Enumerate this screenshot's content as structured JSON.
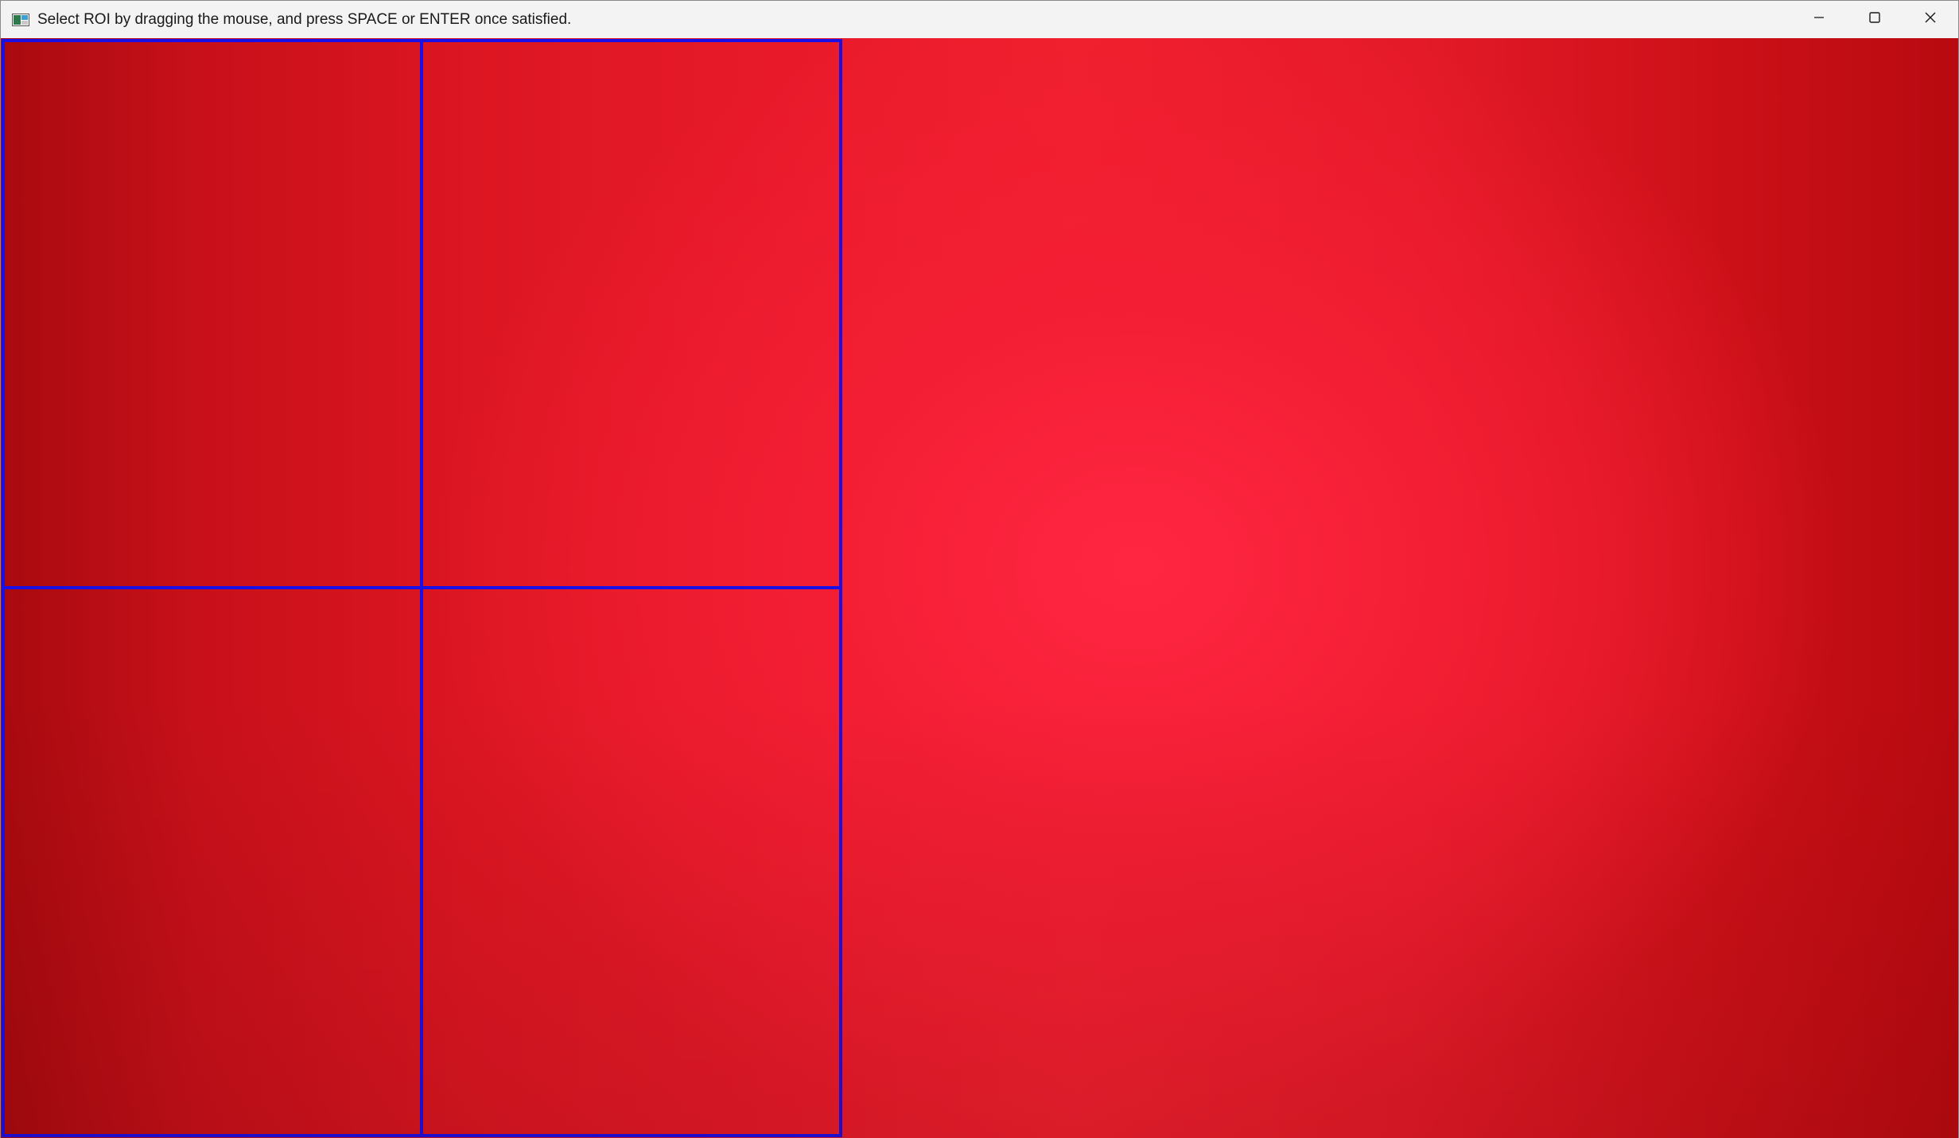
{
  "window": {
    "title": "Select ROI by dragging the mouse, and press SPACE or ENTER once satisfied.",
    "icon": "opencv-window-icon"
  },
  "caption_buttons": {
    "minimize": "minimize-icon",
    "maximize": "maximize-icon",
    "close": "close-icon"
  },
  "canvas": {
    "background_color": "#e81a2a",
    "roi_color": "#1a10e6",
    "roi_grid": {
      "rows": 2,
      "columns": 2
    }
  }
}
